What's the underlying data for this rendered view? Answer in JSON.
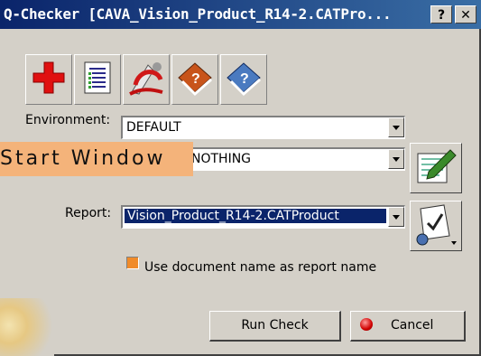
{
  "window": {
    "title": "Q-Checker [CAVA_Vision_Product_R14-2.CATPro...",
    "help_label": "?",
    "close_label": "✕"
  },
  "toolbar": {
    "icons": [
      "red-cross-icon",
      "checklist-icon",
      "cad-rotate-icon",
      "help-book-orange-icon",
      "help-book-blue-icon"
    ]
  },
  "environment": {
    "label": "Environment:",
    "value": "DEFAULT"
  },
  "profile": {
    "value": "NOTHING"
  },
  "report": {
    "label": "Report:",
    "value": "Vision_Product_R14-2.CATProduct"
  },
  "option": {
    "label": "Use document name as report name",
    "checked": true
  },
  "buttons": {
    "run": "Run Check",
    "cancel": "Cancel"
  },
  "overlay": {
    "text": "Start Window"
  },
  "colors": {
    "title_start": "#0a246a",
    "title_end": "#3a6ea5",
    "selection": "#0a246a",
    "overlay": "#f4b37a"
  }
}
